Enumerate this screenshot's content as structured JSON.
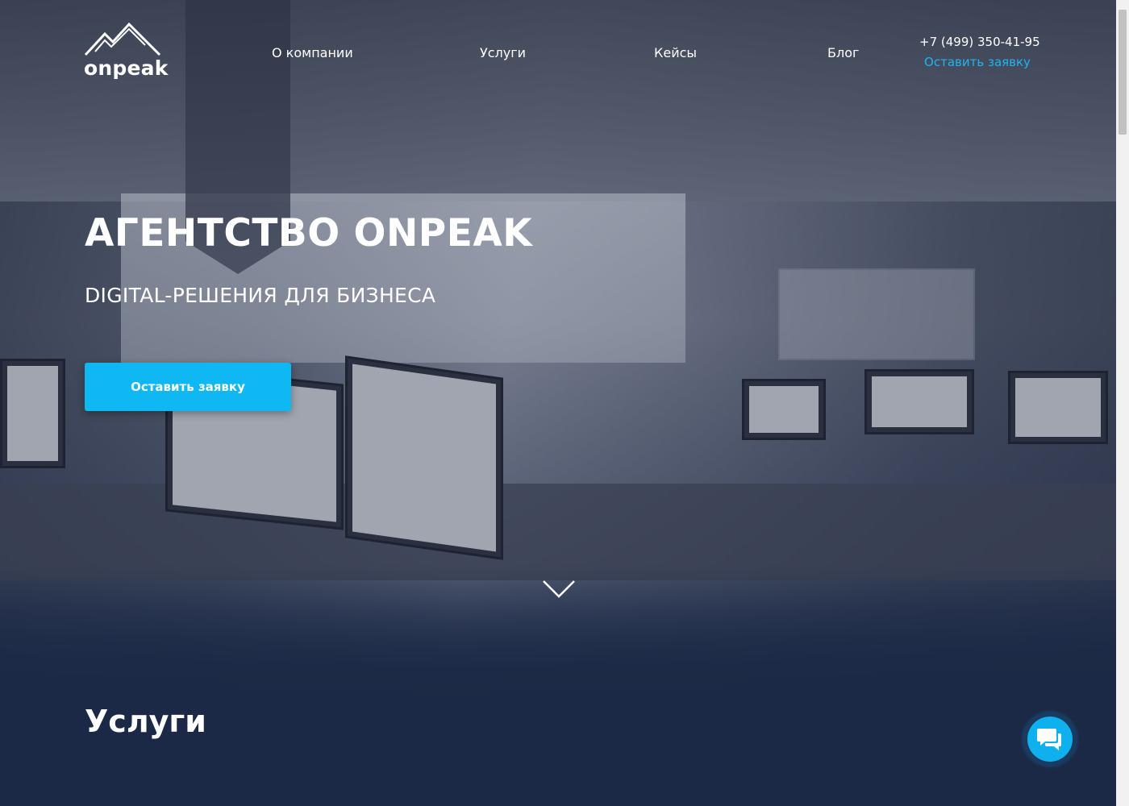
{
  "header": {
    "logo_text": "onpeak",
    "nav": [
      {
        "label": "О компании"
      },
      {
        "label": "Услуги"
      },
      {
        "label": "Кейсы"
      },
      {
        "label": "Блог"
      }
    ],
    "phone": "+7 (499) 350-41-95",
    "request_link": "Оставить заявку"
  },
  "hero": {
    "title": "АГЕНТСТВО ONPEAK",
    "subtitle": "DIGITAL-РЕШЕНИЯ ДЛЯ БИЗНЕСА",
    "cta_label": "Оставить заявку",
    "scroll_icon": "chevron-down-icon"
  },
  "services": {
    "title": "Услуги"
  },
  "chat": {
    "icon": "chat-bubbles-icon"
  },
  "colors": {
    "accent": "#0fb8f2",
    "link": "#1fb4ee",
    "background": "#1b2a45",
    "text": "#ffffff"
  }
}
